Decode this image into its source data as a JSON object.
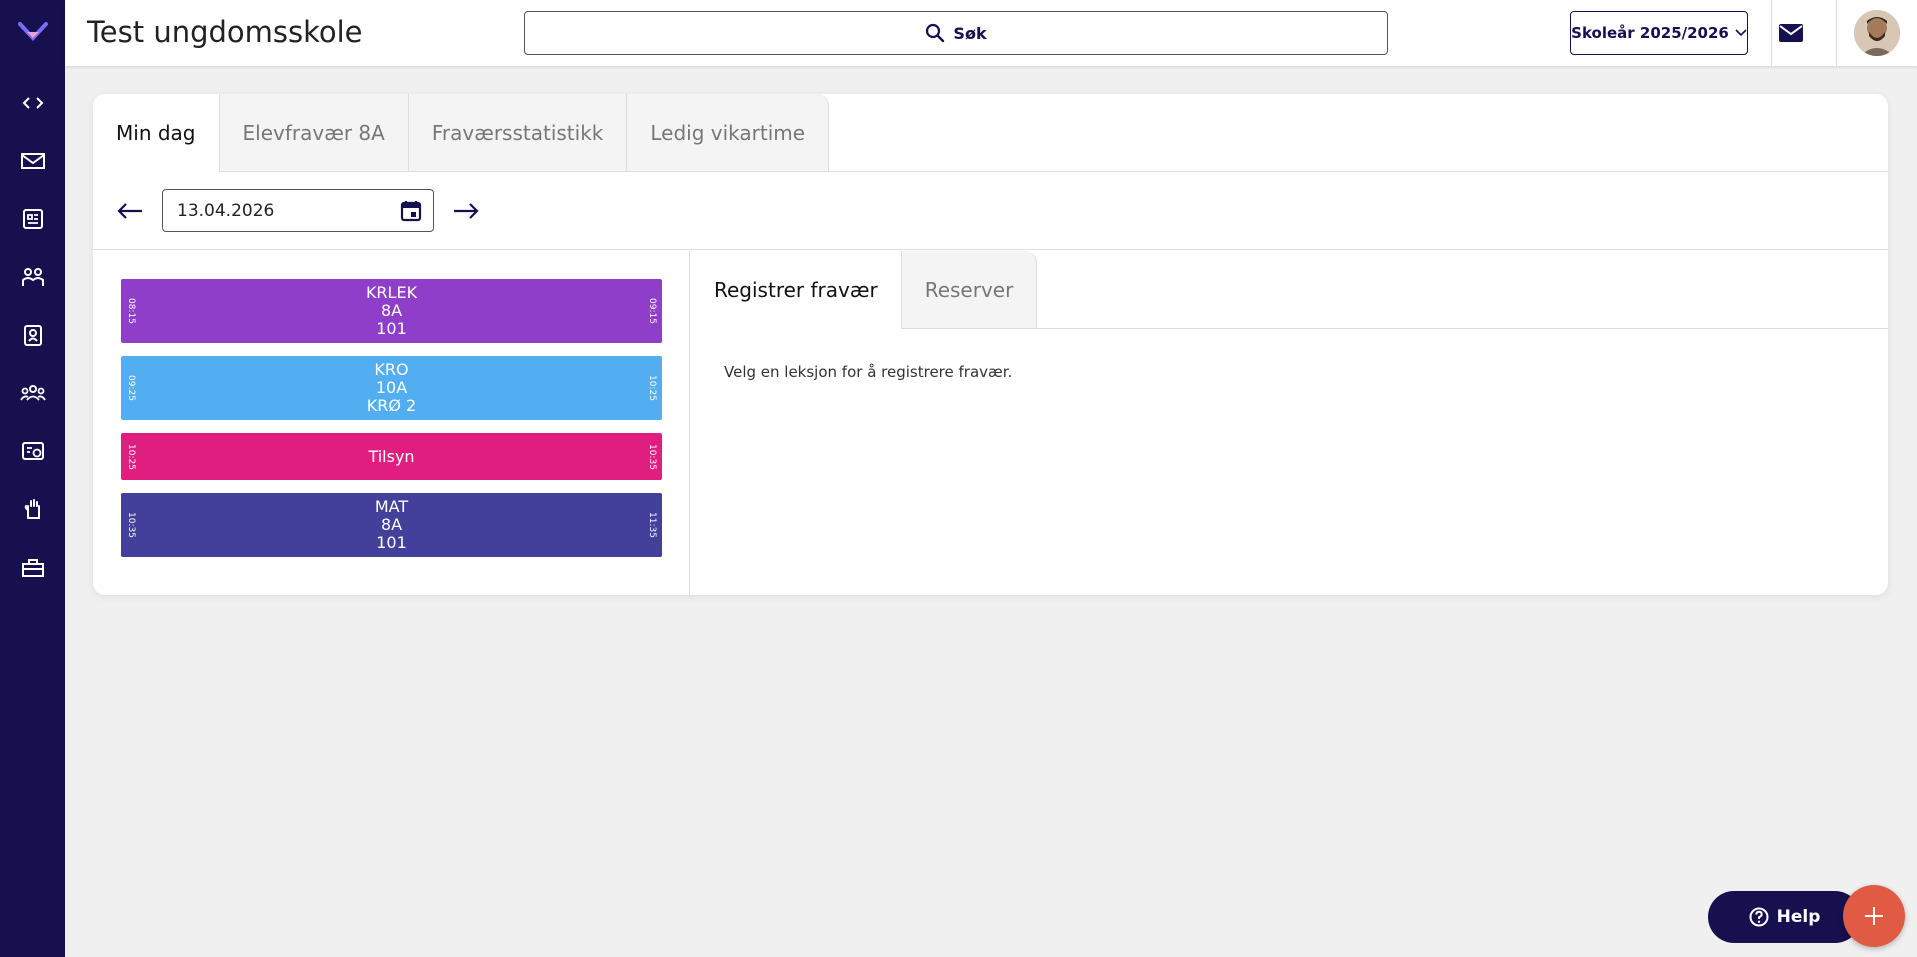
{
  "header": {
    "title": "Test ungdomsskole",
    "search_label": "Søk",
    "school_year": "Skoleår 2025/2026"
  },
  "sidebar": {
    "items": [
      {
        "icon": "code-icon"
      },
      {
        "icon": "mail-icon"
      },
      {
        "icon": "newspaper-icon"
      },
      {
        "icon": "people-icon"
      },
      {
        "icon": "badge-icon"
      },
      {
        "icon": "group-icon"
      },
      {
        "icon": "schedule-icon"
      },
      {
        "icon": "hand-icon"
      },
      {
        "icon": "toolbox-icon"
      }
    ]
  },
  "tabs": [
    {
      "label": "Min dag",
      "active": true
    },
    {
      "label": "Elevfravær 8A"
    },
    {
      "label": "Fraværsstatistikk"
    },
    {
      "label": "Ledig vikartime"
    }
  ],
  "date": {
    "value": "13.04.2026"
  },
  "lessons": [
    {
      "lines": [
        "KRLEK",
        "8A",
        "101"
      ],
      "start": "08:15",
      "end": "09:15",
      "color": "#8e3ec8"
    },
    {
      "lines": [
        "KRO",
        "10A",
        "KRØ 2"
      ],
      "start": "09:25",
      "end": "10:25",
      "color": "#52aef0"
    },
    {
      "lines": [
        "Tilsyn"
      ],
      "start": "10:25",
      "end": "10:35",
      "color": "#e01e80"
    },
    {
      "lines": [
        "MAT",
        "8A",
        "101"
      ],
      "start": "10:35",
      "end": "11:35",
      "color": "#42409a"
    }
  ],
  "register": {
    "tabs": [
      {
        "label": "Registrer fravær",
        "active": true
      },
      {
        "label": "Reserver"
      }
    ],
    "message": "Velg en leksjon for å registrere fravær."
  },
  "help_label": "Help",
  "colors": {
    "sidebar": "#16104f",
    "accent": "#e05a44"
  }
}
